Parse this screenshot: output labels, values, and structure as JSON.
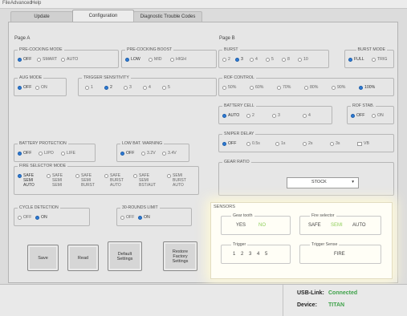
{
  "menu": [
    "File",
    "Advanced",
    "Help"
  ],
  "tabs": [
    {
      "label": "Update",
      "active": false
    },
    {
      "label": "Configuration",
      "active": true
    },
    {
      "label": "Diagnostic Trouble Codes",
      "active": false
    }
  ],
  "page_a": {
    "title": "Page A",
    "precocking_mode": {
      "title": "PRE-COCKING MODE",
      "options": [
        "OFF",
        "SMART",
        "AUTO"
      ],
      "selected": "OFF"
    },
    "precocking_boost": {
      "title": "PRE-COCKING BOOST",
      "options": [
        "LOW",
        "MID",
        "HIGH"
      ],
      "selected": "LOW"
    },
    "aug_mode": {
      "title": "AUG MODE",
      "options": [
        "OFF",
        "ON"
      ],
      "selected": "OFF"
    },
    "trigger_sensitivity": {
      "title": "TRIGGER SENSITIVITY",
      "options": [
        "1",
        "2",
        "3",
        "4",
        "5"
      ],
      "selected": "2"
    },
    "battery_protection": {
      "title": "BATTERY PROTECTION",
      "options": [
        "OFF",
        "LIPO",
        "LIFE"
      ],
      "selected": "OFF"
    },
    "low_bat_warning": {
      "title": "LOW BAT. WARNING",
      "options": [
        "OFF",
        "3.2V",
        "3.4V"
      ],
      "selected": "OFF"
    },
    "fire_selector_mode": {
      "title": "FIRE SELECTOR MODE",
      "options": [
        [
          "SAFE",
          "SEMI",
          "AUTO"
        ],
        [
          "SAFE",
          "SEMI",
          "SEMI"
        ],
        [
          "SAFE",
          "SEMI",
          "BURST"
        ],
        [
          "SAFE",
          "BURST",
          "AUTO"
        ],
        [
          "SAFE",
          "SEMI",
          "BST/AUT"
        ],
        [
          "SEMI",
          "BURST",
          "AUTO"
        ]
      ],
      "selected": 0
    },
    "cycle_detection": {
      "title": "CYCLE DETECTION",
      "options": [
        "OFF",
        "ON"
      ],
      "selected": "ON"
    },
    "rounds_limit": {
      "title": "30-ROUNDS LIMIT",
      "options": [
        "OFF",
        "ON"
      ],
      "selected": "ON"
    }
  },
  "page_b": {
    "title": "Page B",
    "burst": {
      "title": "BURST",
      "options": [
        "2",
        "3",
        "4",
        "5",
        "8",
        "10"
      ],
      "selected": "3"
    },
    "burst_mode": {
      "title": "BURST MODE",
      "options": [
        "FULL",
        "TRIG"
      ],
      "selected": "FULL"
    },
    "rof_control": {
      "title": "ROF CONTROL",
      "options": [
        "50%",
        "60%",
        "70%",
        "80%",
        "90%",
        "100%"
      ],
      "selected": "100%"
    },
    "battery_cell": {
      "title": "BATTERY CELL",
      "options": [
        "AUTO",
        "2",
        "3",
        "4"
      ],
      "selected": "AUTO"
    },
    "rof_stab": {
      "title": "ROF STAB.",
      "options": [
        "OFF",
        "ON"
      ],
      "selected": "OFF"
    },
    "sniper_delay": {
      "title": "SNIPER DELAY",
      "options": [
        "OFF",
        "0.5s",
        "1s",
        "2s",
        "3s"
      ],
      "selected": "OFF",
      "checkbox": "VB"
    },
    "gear_ratio": {
      "title": "GEAR RATIO",
      "value": "STOCK",
      "arrow": "▾"
    }
  },
  "buttons": {
    "save": "Save",
    "read": "Read",
    "default_settings": [
      "Default",
      "Settings"
    ],
    "restore_factory": [
      "Restore",
      "Factory",
      "Settings"
    ]
  },
  "sensors": {
    "title": "SENSORS",
    "gear_tooth": {
      "title": "Gear tooth",
      "values": [
        "YES",
        "NO"
      ],
      "active": "NO"
    },
    "fire_selector": {
      "title": "Fire selector",
      "values": [
        "SAFE",
        "SEMI",
        "AUTO"
      ],
      "active": "SEMI"
    },
    "trigger": {
      "title": "Trigger",
      "values": [
        "1",
        "2",
        "3",
        "4",
        "5"
      ]
    },
    "trigger_sense": {
      "title": "Trigger Sense",
      "value": "FIRE"
    }
  },
  "status": {
    "usb_label": "USB-Link:",
    "usb_value": "Connected",
    "device_label": "Device:",
    "device_value": "TITAN"
  },
  "colors": {
    "radio_on": "#2d7ad6",
    "connected": "#3fa24a",
    "sensor_active": "#8fcf5a",
    "sensor_bg": "#fffef6"
  }
}
